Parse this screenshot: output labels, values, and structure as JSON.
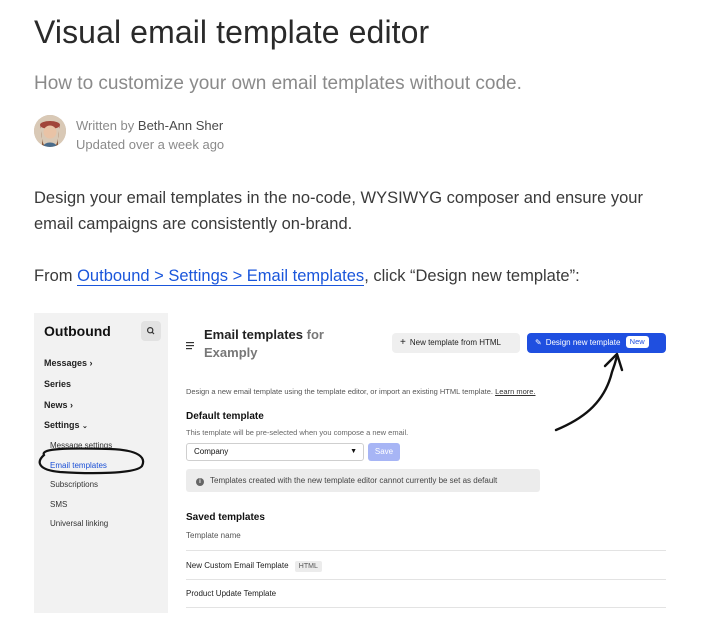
{
  "article": {
    "title": "Visual email template editor",
    "subtitle": "How to customize your own email templates without code.",
    "written_by": "Written by",
    "author_name": "Beth-Ann Sher",
    "updated": "Updated over a week ago",
    "paragraph1": "Design your email templates in the no-code, WYSIWYG composer and ensure your email campaigns are consistently on-brand.",
    "para2_prefix": "From ",
    "para2_link": "Outbound > Settings > Email templates",
    "para2_suffix": ", click “Design new template”:"
  },
  "screenshot": {
    "sidebar": {
      "title": "Outbound",
      "items": [
        "Messages",
        "Series",
        "News",
        "Settings"
      ],
      "settings_subitems": [
        "Message settings",
        "Email templates",
        "Subscriptions",
        "SMS",
        "Universal linking"
      ],
      "active_subitem": "Email templates"
    },
    "header": {
      "title": "Email templates",
      "for_label": "for",
      "workspace": "Examply",
      "btn_html": "New template from HTML",
      "btn_design": "Design new template",
      "badge_new": "New"
    },
    "description": "Design a new email template using the template editor, or import an existing HTML template.",
    "learn_more": "Learn more.",
    "default_template": {
      "heading": "Default template",
      "note": "This template will be pre-selected when you compose a new email.",
      "select_value": "Company",
      "save_label": "Save",
      "notice": "Templates created with the new template editor cannot currently be set as default"
    },
    "saved_templates": {
      "heading": "Saved templates",
      "column": "Template name",
      "rows": [
        {
          "name": "New Custom Email Template",
          "badge": "HTML"
        },
        {
          "name": "Product Update Template",
          "badge": ""
        }
      ]
    }
  },
  "colors": {
    "link": "#1a56db",
    "primary_button": "#1f4fe0",
    "sidebar_bg": "#f2f2f2"
  }
}
